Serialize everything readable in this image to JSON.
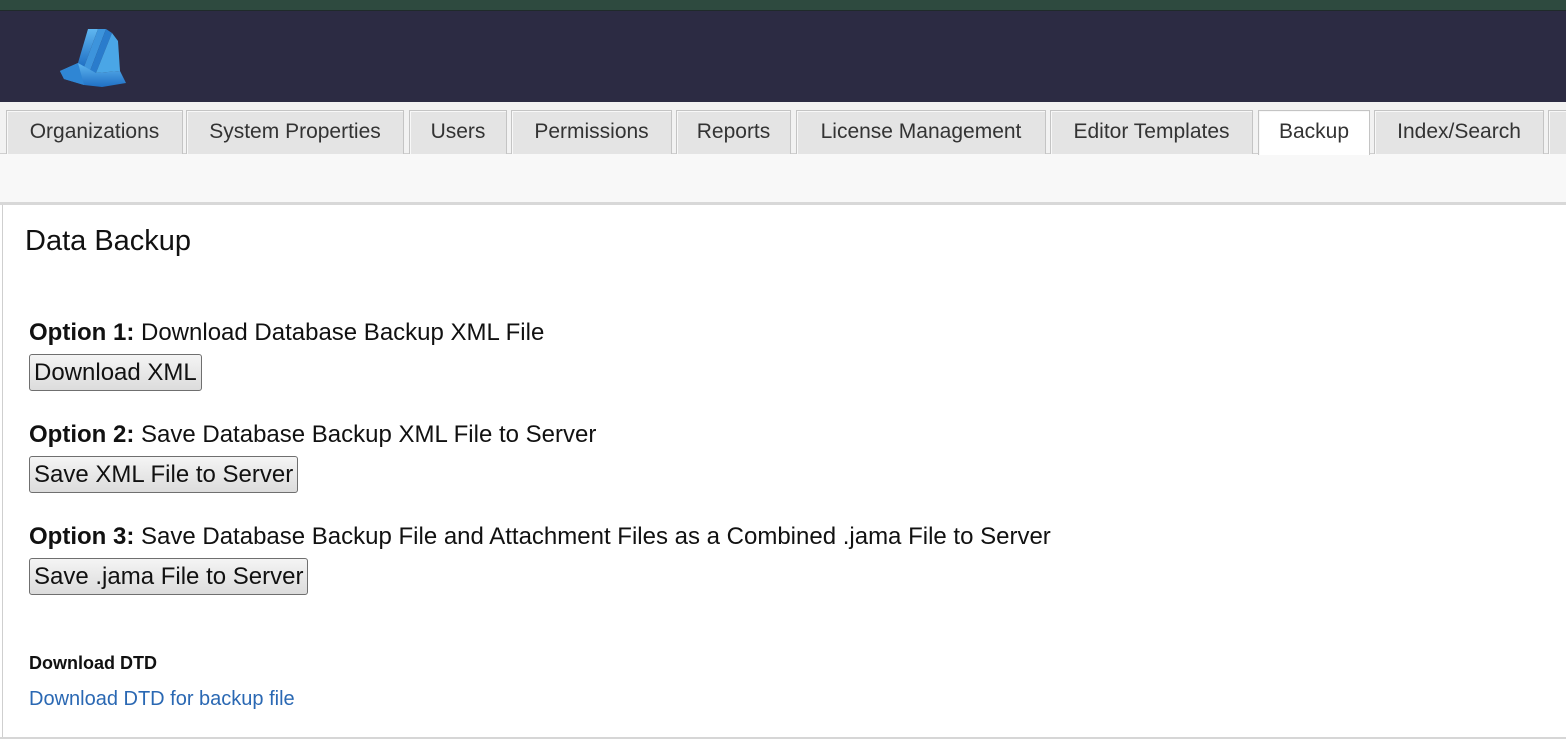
{
  "app": {
    "logo_icon": "jama-logo-icon",
    "header_color": "#2c2b43",
    "accent_link_color": "#2a68b3"
  },
  "tabs": [
    {
      "label": "Organizations",
      "active": false
    },
    {
      "label": "System Properties",
      "active": false
    },
    {
      "label": "Users",
      "active": false
    },
    {
      "label": "Permissions",
      "active": false
    },
    {
      "label": "Reports",
      "active": false
    },
    {
      "label": "License Management",
      "active": false
    },
    {
      "label": "Editor Templates",
      "active": false
    },
    {
      "label": "Backup",
      "active": true
    },
    {
      "label": "Index/Search",
      "active": false
    }
  ],
  "main": {
    "title": "Data Backup",
    "options": [
      {
        "prefix": "Option 1:",
        "text": " Download Database Backup XML File",
        "button_label": "Download XML"
      },
      {
        "prefix": "Option 2:",
        "text": " Save Database Backup XML File to Server",
        "button_label": "Save XML File to Server"
      },
      {
        "prefix": "Option 3:",
        "text": " Save Database Backup File and Attachment Files as a Combined .jama File to Server",
        "button_label": "Save .jama File to Server"
      }
    ],
    "dtd": {
      "heading": "Download DTD",
      "link_text": "Download DTD for backup file"
    }
  }
}
